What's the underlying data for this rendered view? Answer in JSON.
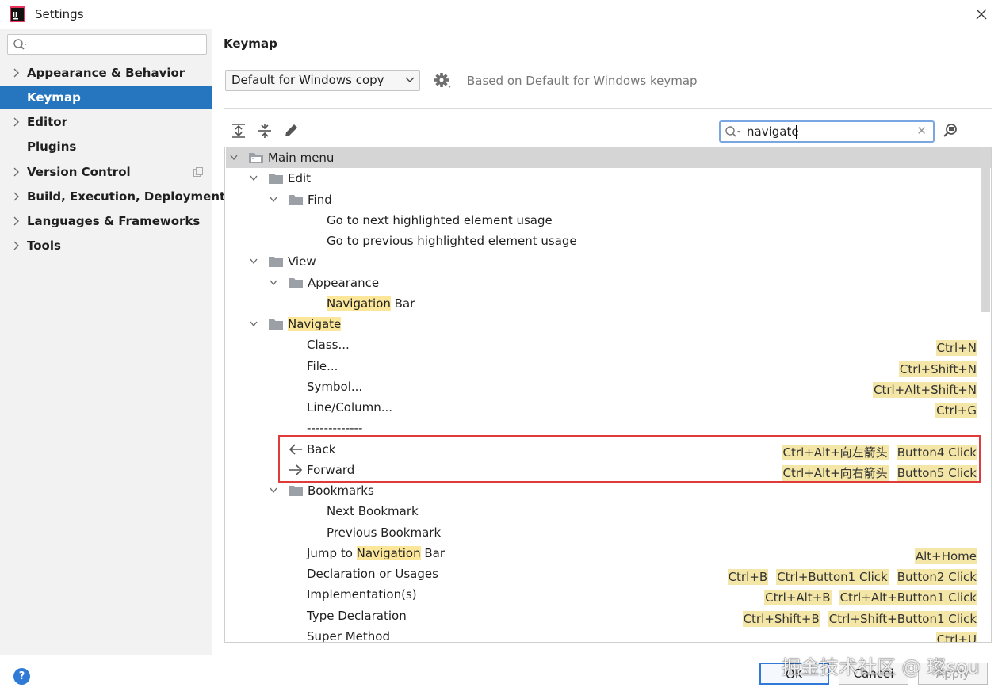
{
  "window": {
    "title": "Settings"
  },
  "sidebar": {
    "search_placeholder": "",
    "items": [
      {
        "label": "Appearance & Behavior",
        "expandable": true,
        "selected": false
      },
      {
        "label": "Keymap",
        "expandable": false,
        "selected": true
      },
      {
        "label": "Editor",
        "expandable": true,
        "selected": false
      },
      {
        "label": "Plugins",
        "expandable": false,
        "selected": false
      },
      {
        "label": "Version Control",
        "expandable": true,
        "selected": false
      },
      {
        "label": "Build, Execution, Deployment",
        "expandable": true,
        "selected": false
      },
      {
        "label": "Languages & Frameworks",
        "expandable": true,
        "selected": false
      },
      {
        "label": "Tools",
        "expandable": true,
        "selected": false
      }
    ]
  },
  "main": {
    "title": "Keymap",
    "keymap_selected": "Default for Windows copy",
    "based_on": "Based on Default for Windows keymap",
    "search_value": "navigate",
    "toolbar_icons": [
      "expand-all-icon",
      "collapse-all-icon",
      "edit-icon"
    ]
  },
  "tree": [
    {
      "parts": [
        "Main menu"
      ],
      "folder": true,
      "expanded": true
    },
    {
      "parts": [
        "Edit"
      ],
      "folder": true,
      "expanded": true
    },
    {
      "parts": [
        "Find"
      ],
      "folder": true,
      "expanded": true
    },
    {
      "parts": [
        "Go to next highlighted element usage"
      ]
    },
    {
      "parts": [
        "Go to previous highlighted element usage"
      ]
    },
    {
      "parts": [
        "View"
      ],
      "folder": true,
      "expanded": true
    },
    {
      "parts": [
        "Appearance"
      ],
      "folder": true,
      "expanded": true
    },
    {
      "parts": [
        "Navigation",
        " Bar"
      ],
      "hl": 0
    },
    {
      "parts": [
        "Navigate"
      ],
      "folder": true,
      "expanded": true,
      "hl": 0
    },
    {
      "parts": [
        "Class..."
      ],
      "shortcuts": [
        "Ctrl+N"
      ]
    },
    {
      "parts": [
        "File..."
      ],
      "shortcuts": [
        "Ctrl+Shift+N"
      ]
    },
    {
      "parts": [
        "Symbol..."
      ],
      "shortcuts": [
        "Ctrl+Alt+Shift+N"
      ]
    },
    {
      "parts": [
        "Line/Column..."
      ],
      "shortcuts": [
        "Ctrl+G"
      ]
    },
    {
      "parts": [
        "-------------"
      ]
    },
    {
      "parts": [
        "Back"
      ],
      "icon": "back-arrow-icon",
      "shortcuts": [
        "Ctrl+Alt+向左箭头",
        "Button4 Click"
      ]
    },
    {
      "parts": [
        "Forward"
      ],
      "icon": "forward-arrow-icon",
      "shortcuts": [
        "Ctrl+Alt+向右箭头",
        "Button5 Click"
      ]
    },
    {
      "parts": [
        "Bookmarks"
      ],
      "folder": true,
      "expanded": true
    },
    {
      "parts": [
        "Next Bookmark"
      ]
    },
    {
      "parts": [
        "Previous Bookmark"
      ]
    },
    {
      "parts": [
        "Jump to ",
        "Navigation",
        " Bar"
      ],
      "hl": 1,
      "shortcuts": [
        "Alt+Home"
      ]
    },
    {
      "parts": [
        "Declaration or Usages"
      ],
      "shortcuts": [
        "Ctrl+B",
        "Ctrl+Button1 Click",
        "Button2 Click"
      ]
    },
    {
      "parts": [
        "Implementation(s)"
      ],
      "shortcuts": [
        "Ctrl+Alt+B",
        "Ctrl+Alt+Button1 Click"
      ]
    },
    {
      "parts": [
        "Type Declaration"
      ],
      "shortcuts": [
        "Ctrl+Shift+B",
        "Ctrl+Shift+Button1 Click"
      ]
    },
    {
      "parts": [
        "Super Method"
      ],
      "shortcuts": [
        "Ctrl+U"
      ]
    }
  ],
  "buttons": {
    "ok": "OK",
    "cancel": "Cancel",
    "apply": "Apply",
    "help": "?"
  },
  "watermark": "掘金技术社区 @ 璨sou",
  "colors": {
    "selection": "#2675bf",
    "highlight": "#fbe69a",
    "shortcut_bg": "#f4e6a6",
    "annotation_box": "#e03b3b"
  }
}
